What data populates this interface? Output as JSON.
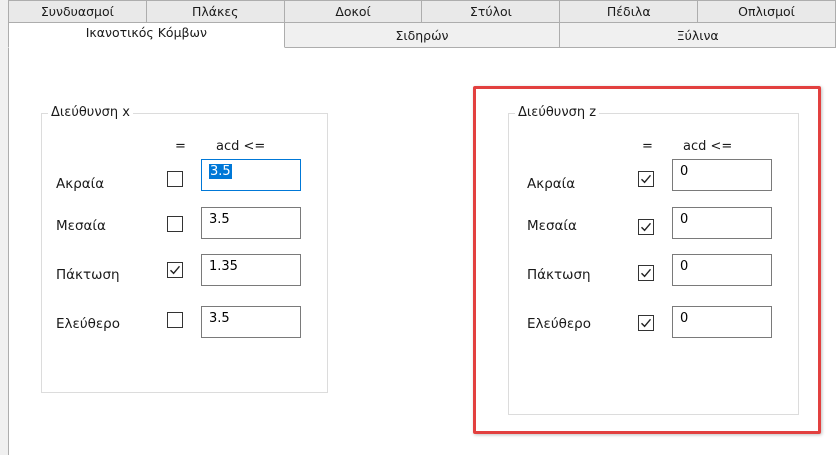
{
  "tabs_row1": [
    "Συνδυασμοί",
    "Πλάκες",
    "Δοκοί",
    "Στύλοι",
    "Πέδιλα",
    "Οπλισμοί"
  ],
  "tabs_row2": [
    "Ικανοτικός Κόμβων",
    "Σιδηρών",
    "Ξύλινα"
  ],
  "active_tab": "Ικανοτικός Κόμβων",
  "col_eq": "=",
  "col_acd": "acd <=",
  "group_x": {
    "title": "Διεύθυνση x",
    "rows": [
      {
        "label": "Ακραία",
        "checked": false,
        "value": "3.5"
      },
      {
        "label": "Μεσαία",
        "checked": false,
        "value": "3.5"
      },
      {
        "label": "Πάκτωση",
        "checked": true,
        "value": "1.35"
      },
      {
        "label": "Ελεύθερο",
        "checked": false,
        "value": "3.5"
      }
    ]
  },
  "group_z": {
    "title": "Διεύθυνση z",
    "rows": [
      {
        "label": "Ακραία",
        "checked": true,
        "value": "0"
      },
      {
        "label": "Μεσαία",
        "checked": true,
        "value": "0"
      },
      {
        "label": "Πάκτωση",
        "checked": true,
        "value": "0"
      },
      {
        "label": "Ελεύθερο",
        "checked": true,
        "value": "0"
      }
    ]
  },
  "colors": {
    "highlight": "#e2403f",
    "focus": "#0078d7",
    "tab_border": "#adadad"
  }
}
